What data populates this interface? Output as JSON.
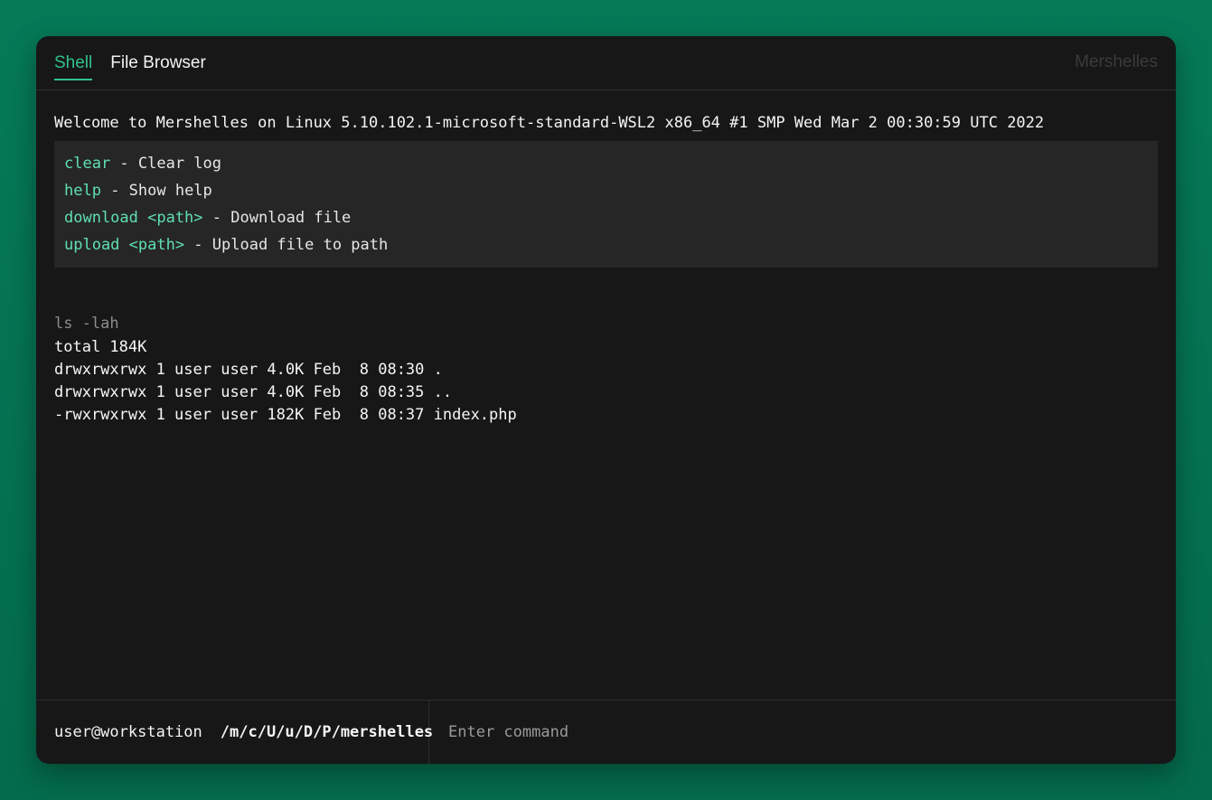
{
  "header": {
    "tabs": [
      {
        "label": "Shell",
        "active": true
      },
      {
        "label": "File Browser",
        "active": false
      }
    ],
    "brand": "Mershelles"
  },
  "terminal": {
    "welcome": "Welcome to Mershelles on Linux 5.10.102.1-microsoft-standard-WSL2 x86_64 #1 SMP Wed Mar 2 00:30:59 UTC 2022",
    "help": [
      {
        "cmd": "clear",
        "desc": " - Clear log"
      },
      {
        "cmd": "help",
        "desc": " - Show help"
      },
      {
        "cmd": "download <path>",
        "desc": " - Download file"
      },
      {
        "cmd": "upload <path>",
        "desc": " - Upload file to path"
      }
    ],
    "command": "ls -lah",
    "output": [
      "total 184K",
      "drwxrwxrwx 1 user user 4.0K Feb  8 08:30 .",
      "drwxrwxrwx 1 user user 4.0K Feb  8 08:35 ..",
      "-rwxrwxrwx 1 user user 182K Feb  8 08:37 index.php"
    ]
  },
  "footer": {
    "user_host": "user@workstation",
    "path": "/m/c/U/u/D/P/mershelles",
    "input_placeholder": "Enter command",
    "input_value": ""
  },
  "colors": {
    "background": "#057a57",
    "accent": "#2fc28a",
    "help_command": "#5fe0b0",
    "window": "#171717"
  }
}
